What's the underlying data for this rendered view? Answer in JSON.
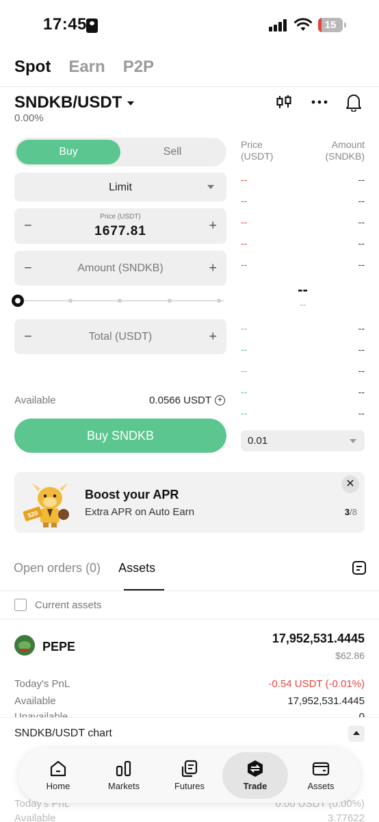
{
  "status_bar": {
    "time": "17:45",
    "battery": "15",
    "battery_fraction": 0.15
  },
  "top_tabs": [
    "Spot",
    "Earn",
    "P2P"
  ],
  "pair": {
    "name": "SNDKB/USDT",
    "change": "0.00%"
  },
  "order_form": {
    "buy_label": "Buy",
    "sell_label": "Sell",
    "order_type": "Limit",
    "price_caption": "Price (USDT)",
    "price_value": "1677.81",
    "amount_placeholder": "Amount (SNDKB)",
    "total_placeholder": "Total (USDT)",
    "available_label": "Available",
    "available_value": "0.0566 USDT",
    "submit_label": "Buy SNDKB",
    "minus": "−",
    "plus": "+",
    "slider_fraction": 0
  },
  "order_book": {
    "price_header": "Price\n(USDT)",
    "amount_header": "Amount\n(SNDKB)",
    "asks": [
      [
        "--",
        "--"
      ],
      [
        "--",
        "--"
      ],
      [
        "--",
        "--"
      ],
      [
        "--",
        "--"
      ],
      [
        "--",
        "--"
      ]
    ],
    "mid_price": "--",
    "mid_sub": "--",
    "bids": [
      [
        "--",
        "--"
      ],
      [
        "--",
        "--"
      ],
      [
        "--",
        "--"
      ],
      [
        "--",
        "--"
      ],
      [
        "--",
        "--"
      ]
    ],
    "tick_size": "0.01"
  },
  "banner": {
    "title": "Boost your APR",
    "subtitle": "Extra APR on Auto Earn",
    "page_current": "3",
    "page_total": "/8",
    "badge": "$20"
  },
  "assets_tabs": {
    "open_orders": "Open orders (0)",
    "assets": "Assets"
  },
  "current_assets_label": "Current assets",
  "asset": {
    "symbol": "PEPE",
    "balance": "17,952,531.4445",
    "usd_value": "$62.86",
    "pnl_label": "Today's PnL",
    "pnl_value": "-0.54 USDT (-0.01%)",
    "available_label": "Available",
    "available_value": "17,952,531.4445",
    "unavailable_label": "Unavailable",
    "unavailable_value": "0"
  },
  "chart_bar": {
    "label": "SNDKB/USDT chart"
  },
  "hidden_rows": {
    "pnl_label": "Today's PnL",
    "pnl_value": "0.00 USDT (0.00%)",
    "available_label": "Available",
    "available_value": "3.77622"
  },
  "bottom_nav": [
    {
      "label": "Home",
      "icon": "home-icon"
    },
    {
      "label": "Markets",
      "icon": "markets-icon"
    },
    {
      "label": "Futures",
      "icon": "futures-icon"
    },
    {
      "label": "Trade",
      "icon": "trade-icon",
      "active": true
    },
    {
      "label": "Assets",
      "icon": "wallet-icon"
    }
  ],
  "colors": {
    "buy_green": "#5bc68f",
    "sell_red": "#e5443c",
    "battery_red": "#e5443c"
  }
}
